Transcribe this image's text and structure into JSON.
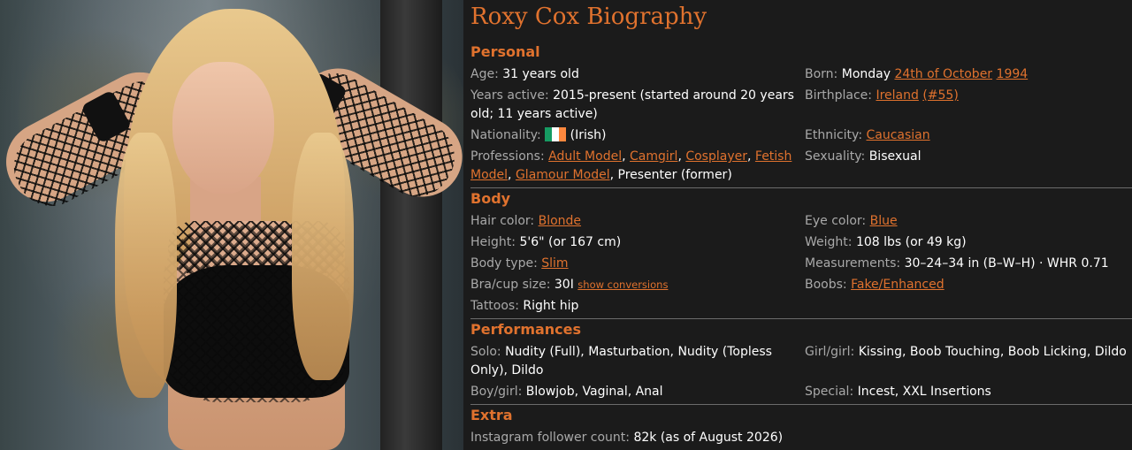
{
  "title": "Roxy Cox Biography",
  "sections": {
    "personal": {
      "heading": "Personal",
      "age": {
        "label": "Age:",
        "value": "31 years old"
      },
      "born": {
        "label": "Born:",
        "prefix": "Monday",
        "date_link": "24th of October",
        "year_link": "1994"
      },
      "years_active": {
        "label": "Years active:",
        "value": "2015-present (started around 20 years old; 11 years active)"
      },
      "birthplace": {
        "label": "Birthplace:",
        "place_link": "Ireland",
        "rank_link": "(#55)"
      },
      "nationality": {
        "label": "Nationality:",
        "value": "(Irish)",
        "flag": "ireland-flag"
      },
      "ethnicity": {
        "label": "Ethnicity:",
        "value_link": "Caucasian"
      },
      "professions": {
        "label": "Professions:",
        "links": [
          "Adult Model",
          "Camgirl",
          "Cosplayer",
          "Fetish Model",
          "Glamour Model"
        ],
        "sep": ",",
        "tail": ", Presenter (former)"
      },
      "sexuality": {
        "label": "Sexuality:",
        "value": "Bisexual"
      }
    },
    "body": {
      "heading": "Body",
      "hair_color": {
        "label": "Hair color:",
        "value_link": "Blonde"
      },
      "eye_color": {
        "label": "Eye color:",
        "value_link": "Blue"
      },
      "height": {
        "label": "Height:",
        "value": "5'6\" (or 167 cm)"
      },
      "weight": {
        "label": "Weight:",
        "value": "108 lbs (or 49 kg)"
      },
      "body_type": {
        "label": "Body type:",
        "value_link": "Slim"
      },
      "measurements": {
        "label": "Measurements:",
        "value": "30–24–34 in (B–W–H) · WHR 0.71"
      },
      "bra_cup": {
        "label": "Bra/cup size:",
        "value": "30I",
        "conversion_link": "show conversions"
      },
      "boobs": {
        "label": "Boobs:",
        "value_link": "Fake/Enhanced"
      },
      "tattoos": {
        "label": "Tattoos:",
        "value": "Right hip"
      }
    },
    "performances": {
      "heading": "Performances",
      "solo": {
        "label": "Solo:",
        "value": "Nudity (Full), Masturbation, Nudity (Topless Only), Dildo"
      },
      "girl_girl": {
        "label": "Girl/girl:",
        "value": "Kissing, Boob Touching, Boob Licking, Dildo"
      },
      "boy_girl": {
        "label": "Boy/girl:",
        "value": "Blowjob, Vaginal, Anal"
      },
      "special": {
        "label": "Special:",
        "value": "Incest, XXL Insertions"
      }
    },
    "extra": {
      "heading": "Extra",
      "instagram": {
        "label": "Instagram follower count:",
        "value": "82k (as of August 2026)"
      }
    }
  },
  "colors": {
    "accent": "#e0722e",
    "label": "#a9a9a9",
    "value": "#ffffff",
    "background": "#1b1b1b"
  }
}
